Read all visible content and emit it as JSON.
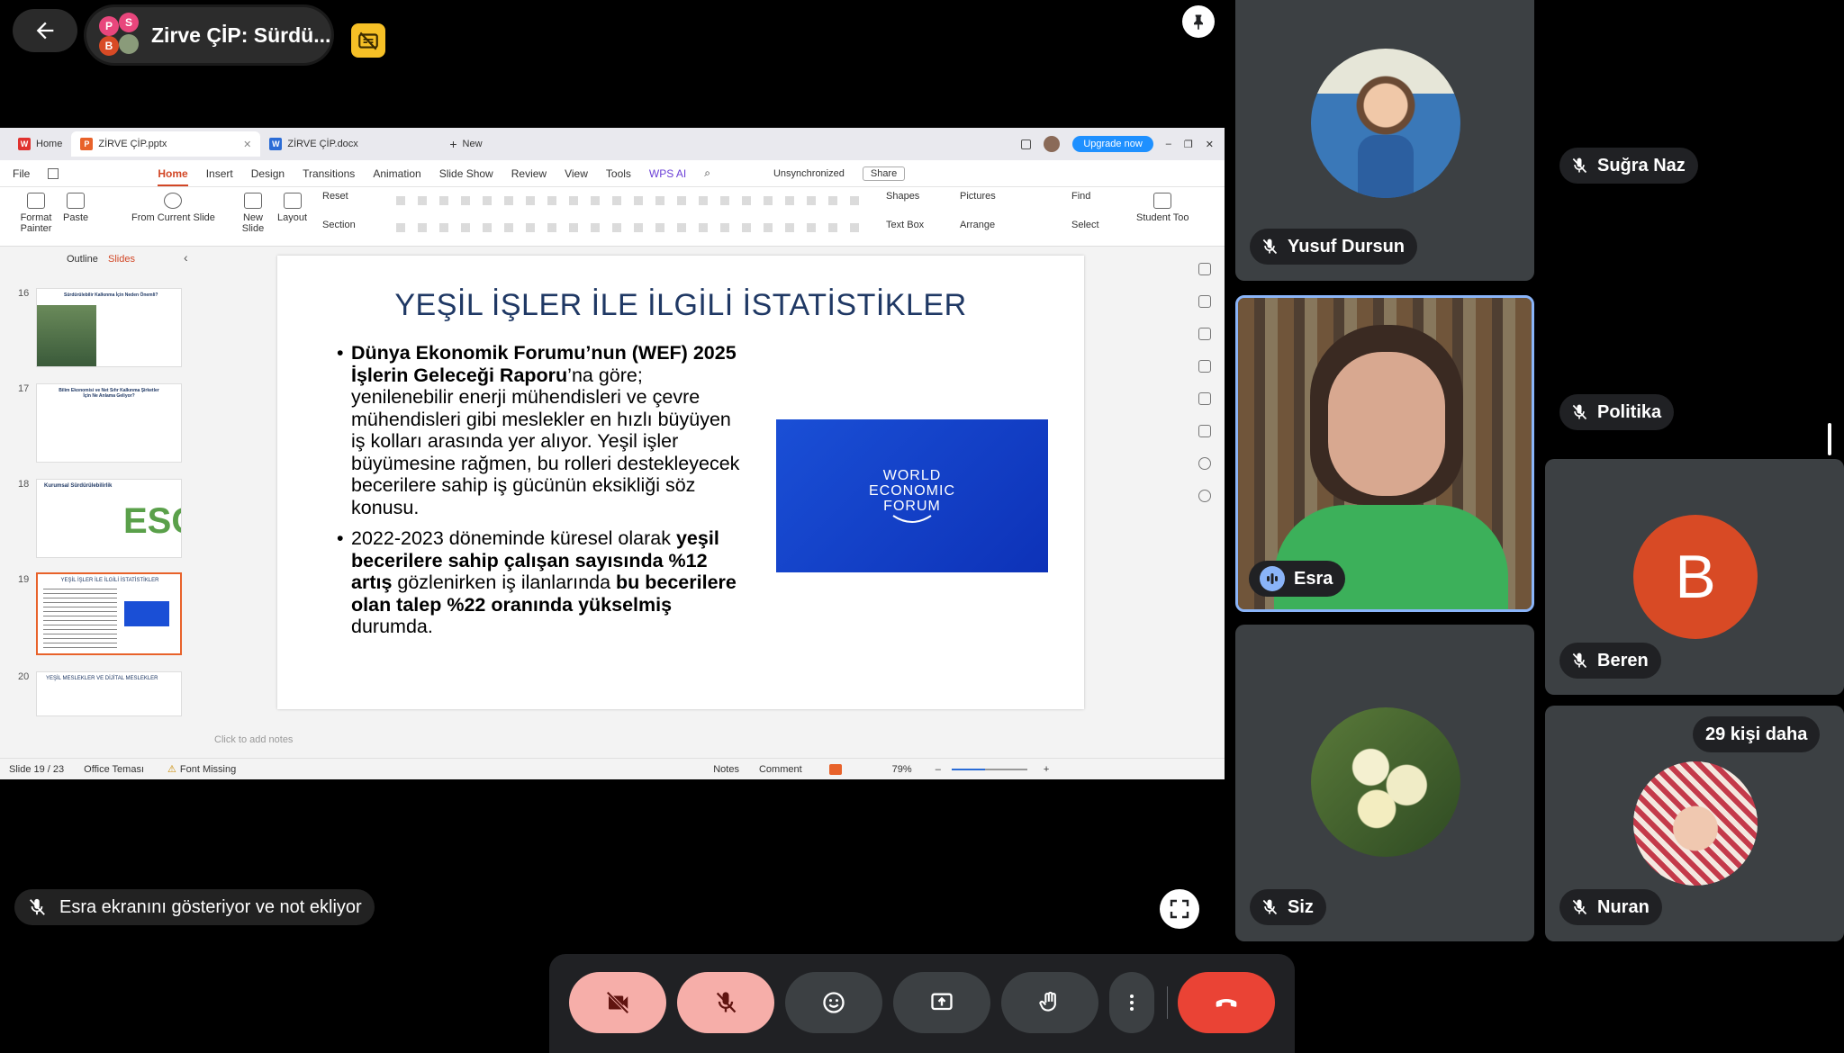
{
  "meeting": {
    "title": "Zirve ÇİP: Sürdü...",
    "participant_initials": [
      "P",
      "S",
      "B"
    ],
    "presenting_message": "Esra ekranını gösteriyor ve not ekliyor",
    "more_participants": "29 kişi daha"
  },
  "wps": {
    "tabs": [
      {
        "label": "Home",
        "icon": "wps-logo-icon"
      },
      {
        "label": "ZİRVE ÇİP.pptx",
        "icon": "presentation-file-icon"
      },
      {
        "label": "ZİRVE ÇİP.docx",
        "icon": "word-file-icon"
      },
      {
        "label": "New",
        "icon": "plus-icon"
      }
    ],
    "upgrade_label": "Upgrade now",
    "menu": [
      "File",
      "Home",
      "Insert",
      "Design",
      "Transitions",
      "Animation",
      "Slide Show",
      "Review",
      "View",
      "Tools",
      "WPS AI"
    ],
    "sync_label": "Unsynchronized",
    "share_label": "Share",
    "ribbon": {
      "format_painter": "Format Painter",
      "paste": "Paste",
      "from_current_slide": "From Current Slide",
      "new_slide": "New Slide",
      "layout": "Layout",
      "reset": "Reset",
      "section": "Section",
      "shapes": "Shapes",
      "pictures": "Pictures",
      "text_box": "Text Box",
      "arrange": "Arrange",
      "find": "Find",
      "select": "Select",
      "student_tools": "Student Too"
    },
    "panel_tabs": [
      "Outline",
      "Slides"
    ],
    "thumbnails": [
      {
        "num": "16",
        "caption": "Sürdürülebilir Kalkınma İçin Neden Önemli?"
      },
      {
        "num": "17",
        "caption": "Bilim Ekonomisi ve Net Sıfır Kalkınma Şirketler İçin Ne Anlama Geliyor?"
      },
      {
        "num": "18",
        "caption": "Kurumsal Sürdürülebilirlik"
      },
      {
        "num": "19",
        "caption": "YEŞİL İŞLER İLE İLGİLİ İSTATİSTİKLER"
      },
      {
        "num": "20",
        "caption": "YEŞİL MESLEKLER VE DİJİTAL MESLEKLER"
      }
    ],
    "thumb18_esg": "ESG",
    "notes_placeholder": "Click to add notes",
    "status": {
      "slide": "Slide 19 / 23",
      "theme": "Office Teması",
      "font": "Font Missing",
      "notes": "Notes",
      "comment": "Comment",
      "zoom": "79%"
    }
  },
  "slide": {
    "title": "YEŞİL İŞLER İLE İLGİLİ İSTATİSTİKLER",
    "b1_bold": "Dünya Ekonomik Forumu’nun (WEF) 2025 İşlerin Geleceği Raporu",
    "b1_rest": "’na göre; yenilenebilir enerji mühendisleri ve çevre mühendisleri gibi meslekler en hızlı büyüyen iş kolları arasında yer alıyor. Yeşil işler büyümesine rağmen, bu rolleri destekleyecek becerilere sahip iş gücünün eksikliği söz konusu.",
    "b2_p1": "2022-2023 döneminde küresel olarak ",
    "b2_b1": "yeşil becerilere sahip çalışan sayısında %12 artış",
    "b2_p2": " gözlenirken iş ilanlarında ",
    "b2_b2": "bu becerilere olan talep %22 oranında yükselmiş",
    "b2_p3": " durumda.",
    "wef_logo": [
      "WORLD",
      "ECONOMIC",
      "FORUM"
    ]
  },
  "participants": [
    {
      "name": "Yusuf Dursun",
      "muted": true
    },
    {
      "name": "Suğra Naz",
      "muted": true
    },
    {
      "name": "Esra",
      "muted": false,
      "speaking": true
    },
    {
      "name": "Politika",
      "muted": true
    },
    {
      "name": "Beren",
      "muted": true,
      "initial": "B",
      "color": "#d84a25"
    },
    {
      "name": "Siz",
      "muted": true
    },
    {
      "name": "Nuran",
      "muted": true
    }
  ],
  "colors": {
    "end_call": "#ea4335",
    "muted_button": "#f6aea9",
    "active_speaker_border": "#8ab4f8",
    "upgrade": "#1e90ff"
  }
}
